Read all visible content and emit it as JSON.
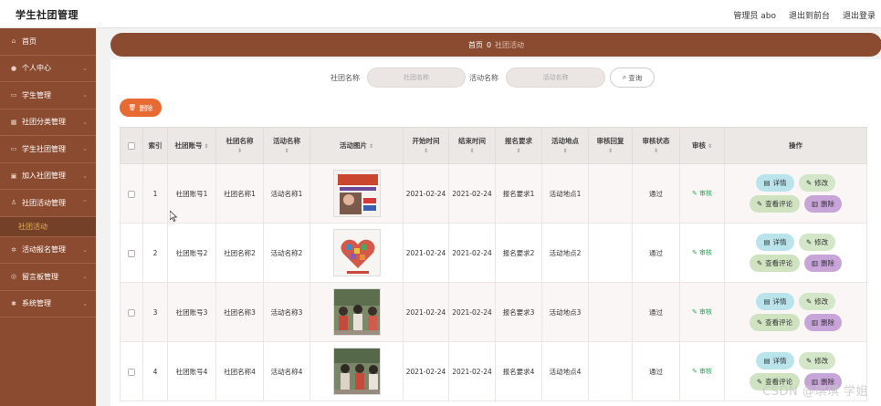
{
  "app": {
    "title": "学生社团管理"
  },
  "header": {
    "admin_label": "管理员 abo",
    "front_link": "退出到前台",
    "logout_link": "退出登录"
  },
  "sidebar": {
    "items": [
      {
        "label": "首页",
        "icon": "home-icon",
        "has_chevron": false
      },
      {
        "label": "个人中心",
        "icon": "user-icon",
        "has_chevron": true
      },
      {
        "label": "学生管理",
        "icon": "id-card-icon",
        "has_chevron": true
      },
      {
        "label": "社团分类管理",
        "icon": "grid-icon",
        "has_chevron": true
      },
      {
        "label": "学生社团管理",
        "icon": "monitor-icon",
        "has_chevron": true
      },
      {
        "label": "加入社团管理",
        "icon": "folder-icon",
        "has_chevron": true
      },
      {
        "label": "社团活动管理",
        "icon": "person-icon",
        "has_chevron": true,
        "expanded": true,
        "sub": "社团活动"
      },
      {
        "label": "活动报名管理",
        "icon": "gear-icon",
        "has_chevron": true
      },
      {
        "label": "留言板管理",
        "icon": "globe-icon",
        "has_chevron": true
      },
      {
        "label": "系统管理",
        "icon": "settings-icon",
        "has_chevron": true
      }
    ],
    "active_sub": "社团活动"
  },
  "breadcrumb": {
    "home": "首页",
    "separator": "0",
    "current": "社团活动"
  },
  "search": {
    "club_label": "社团名称",
    "club_placeholder": "社团名称",
    "activity_label": "活动名称",
    "activity_placeholder": "活动名称",
    "query_button": "查询"
  },
  "toolbar": {
    "delete_label": "删除"
  },
  "table": {
    "headers": {
      "index": "索引",
      "club_account": "社团账号",
      "club_name": "社团名称",
      "activity_name": "活动名称",
      "activity_image": "活动图片",
      "start_time": "开始时间",
      "end_time": "结束时间",
      "signup_req": "报名要求",
      "location": "活动地点",
      "audit_reply": "审核回复",
      "audit_status": "审核状态",
      "audit": "审核",
      "actions": "操作"
    },
    "rows": [
      {
        "index": "1",
        "club_account": "社团账号1",
        "club_name": "社团名称1",
        "activity_name": "活动名称1",
        "start": "2021-02-24",
        "end": "2021-02-24",
        "signup_req": "报名要求1",
        "location": "活动地点1",
        "audit_reply": "",
        "audit_status": "通过",
        "audit_action": "审核"
      },
      {
        "index": "2",
        "club_account": "社团账号2",
        "club_name": "社团名称2",
        "activity_name": "活动名称2",
        "start": "2021-02-24",
        "end": "2021-02-24",
        "signup_req": "报名要求2",
        "location": "活动地点2",
        "audit_reply": "",
        "audit_status": "通过",
        "audit_action": "审核"
      },
      {
        "index": "3",
        "club_account": "社团账号3",
        "club_name": "社团名称3",
        "activity_name": "活动名称3",
        "start": "2021-02-24",
        "end": "2021-02-24",
        "signup_req": "报名要求3",
        "location": "活动地点3",
        "audit_reply": "",
        "audit_status": "通过",
        "audit_action": "审核"
      },
      {
        "index": "4",
        "club_account": "社团账号4",
        "club_name": "社团名称4",
        "activity_name": "活动名称4",
        "start": "2021-02-24",
        "end": "2021-02-24",
        "signup_req": "报名要求4",
        "location": "活动地点4",
        "audit_reply": "",
        "audit_status": "通过",
        "audit_action": "审核"
      }
    ],
    "actions": {
      "detail": "详情",
      "edit": "修改",
      "review": "查看评论",
      "delete": "删除"
    }
  },
  "watermark": "CSDN @琪琪 学姐",
  "colors": {
    "sidebar": "#8a4b30",
    "accent_orange": "#e76a33",
    "active_sub": "#e8b14a",
    "audit_green": "#2ca35a"
  }
}
